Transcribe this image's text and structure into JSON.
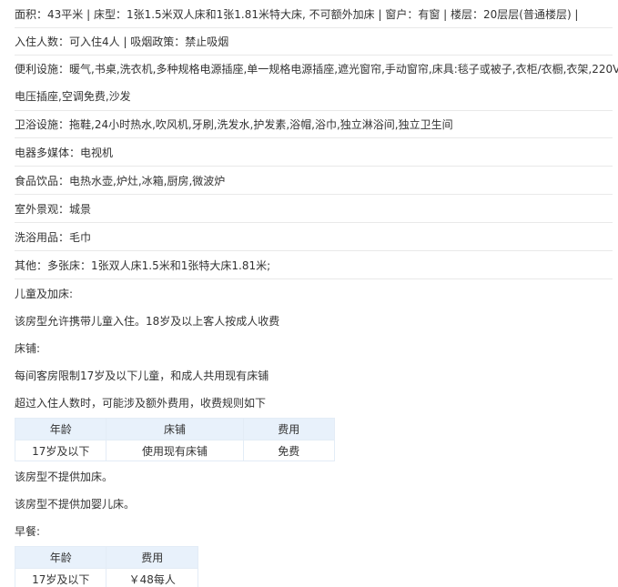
{
  "room": {
    "line1": "面积：43平米 | 床型：1张1.5米双人床和1张1.81米特大床, 不可额外加床 | 窗户：有窗 | 楼层：20层层(普通楼层) |",
    "line2": " 入住人数：可入住4人 | 吸烟政策：禁止吸烟"
  },
  "facilities": {
    "convenience": {
      "label": "便利设施：",
      "value_line1": "暖气,书桌,洗衣机,多种规格电源插座,单一规格电源插座,遮光窗帘,手动窗帘,床具:毯子或被子,衣柜/衣橱,衣架,220V",
      "value_line2": "电压插座,空调免费,沙发"
    },
    "bathroom": {
      "label": "卫浴设施：",
      "value": "拖鞋,24小时热水,吹风机,牙刷,洗发水,护发素,浴帽,浴巾,独立淋浴间,独立卫生间"
    },
    "media": {
      "label": "电器多媒体：",
      "value": "电视机"
    },
    "food": {
      "label": "食品饮品：",
      "value": "电热水壶,炉灶,冰箱,厨房,微波炉"
    },
    "view": {
      "label": "室外景观：",
      "value": "城景"
    },
    "toiletries": {
      "label": "洗浴用品：",
      "value": "毛巾"
    },
    "other": {
      "label": "其他：",
      "value": "多张床：1张双人床1.5米和1张特大床1.81米;"
    }
  },
  "children": {
    "heading": "儿童及加床:",
    "policy": "该房型允许携带儿童入住。18岁及以上客人按成人收费",
    "bed_heading": "床铺:",
    "bed_limit": "每间客房限制17岁及以下儿童，和成人共用现有床铺",
    "extra_note": "超过入住人数时，可能涉及额外费用，收费规则如下",
    "bed_table": {
      "headers": [
        "年龄",
        "床铺",
        "费用"
      ],
      "rows": [
        {
          "age": "17岁及以下",
          "bed": "使用现有床铺",
          "fee": "免费"
        }
      ]
    },
    "no_extra_bed": "该房型不提供加床。",
    "no_crib": "该房型不提供加婴儿床。"
  },
  "breakfast": {
    "heading": "早餐:",
    "table": {
      "headers": [
        "年龄",
        "费用"
      ],
      "rows": [
        {
          "age": "17岁及以下",
          "fee": "￥48每人"
        }
      ]
    }
  },
  "colors": {
    "text": "#333333",
    "table_header_bg": "#e8f1fb",
    "free_link": "#3a8ee6",
    "divider": "#e9e9e9"
  }
}
